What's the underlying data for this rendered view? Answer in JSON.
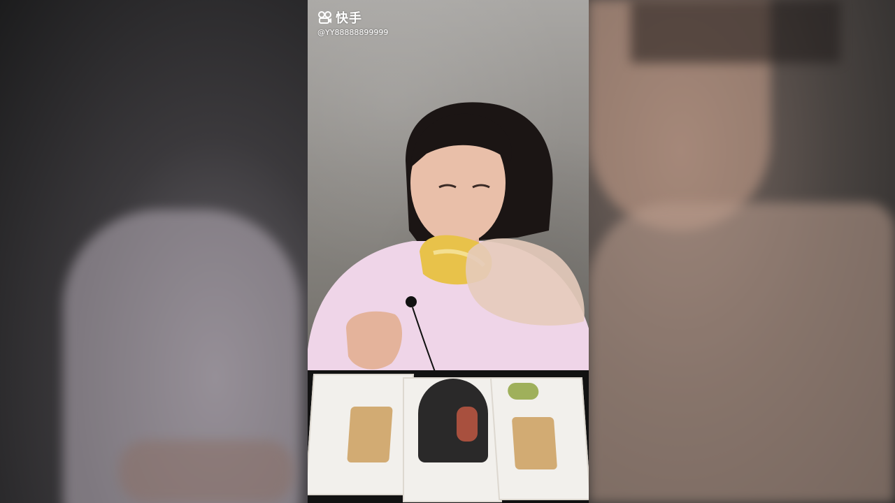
{
  "watermark": {
    "logo_text": "快手",
    "handle": "@YY88888899999"
  },
  "colors": {
    "shirt": "#efd5e8",
    "skin": "#e9bfa9",
    "hair": "#1b1514",
    "omelet": "#e8c24a",
    "tray": "#f2f0ec",
    "table": "#121212"
  }
}
